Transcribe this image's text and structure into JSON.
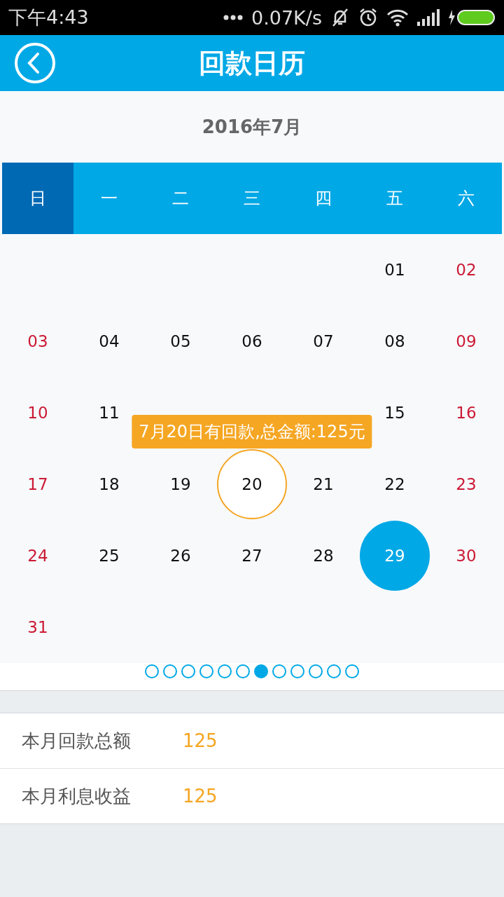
{
  "status_bar": {
    "time": "下午4:43",
    "speed": "0.07K/s"
  },
  "header": {
    "title": "回款日历"
  },
  "month": "2016年7月",
  "weekdays": [
    {
      "label": "日",
      "selected": true
    },
    {
      "label": "一",
      "selected": false
    },
    {
      "label": "二",
      "selected": false
    },
    {
      "label": "三",
      "selected": false
    },
    {
      "label": "四",
      "selected": false
    },
    {
      "label": "五",
      "selected": false
    },
    {
      "label": "六",
      "selected": false
    }
  ],
  "weeks": [
    [
      {
        "kind": "blank"
      },
      {
        "kind": "blank"
      },
      {
        "kind": "blank"
      },
      {
        "kind": "blank"
      },
      {
        "kind": "blank"
      },
      {
        "kind": "day",
        "day": "01",
        "marked": false,
        "selected": false
      },
      {
        "kind": "day",
        "day": "02",
        "marked": false,
        "selected": false
      }
    ],
    [
      {
        "kind": "day",
        "day": "03",
        "marked": false,
        "selected": false
      },
      {
        "kind": "day",
        "day": "04",
        "marked": false,
        "selected": false
      },
      {
        "kind": "day",
        "day": "05",
        "marked": false,
        "selected": false
      },
      {
        "kind": "day",
        "day": "06",
        "marked": false,
        "selected": false
      },
      {
        "kind": "day",
        "day": "07",
        "marked": false,
        "selected": false
      },
      {
        "kind": "day",
        "day": "08",
        "marked": false,
        "selected": false
      },
      {
        "kind": "day",
        "day": "09",
        "marked": false,
        "selected": false
      }
    ],
    [
      {
        "kind": "day",
        "day": "10",
        "marked": false,
        "selected": false
      },
      {
        "kind": "day",
        "day": "11",
        "marked": false,
        "selected": false
      },
      {
        "kind": "blank"
      },
      {
        "kind": "blank"
      },
      {
        "kind": "blank"
      },
      {
        "kind": "day",
        "day": "15",
        "marked": false,
        "selected": false
      },
      {
        "kind": "day",
        "day": "16",
        "marked": false,
        "selected": false
      }
    ],
    [
      {
        "kind": "day",
        "day": "17",
        "marked": false,
        "selected": false
      },
      {
        "kind": "day",
        "day": "18",
        "marked": false,
        "selected": false
      },
      {
        "kind": "day",
        "day": "19",
        "marked": false,
        "selected": false
      },
      {
        "kind": "day",
        "day": "20",
        "marked": true,
        "selected": false
      },
      {
        "kind": "day",
        "day": "21",
        "marked": false,
        "selected": false
      },
      {
        "kind": "day",
        "day": "22",
        "marked": false,
        "selected": false
      },
      {
        "kind": "day",
        "day": "23",
        "marked": false,
        "selected": false
      }
    ],
    [
      {
        "kind": "day",
        "day": "24",
        "marked": false,
        "selected": false
      },
      {
        "kind": "day",
        "day": "25",
        "marked": false,
        "selected": false
      },
      {
        "kind": "day",
        "day": "26",
        "marked": false,
        "selected": false
      },
      {
        "kind": "day",
        "day": "27",
        "marked": false,
        "selected": false
      },
      {
        "kind": "day",
        "day": "28",
        "marked": false,
        "selected": false
      },
      {
        "kind": "day",
        "day": "29",
        "marked": false,
        "selected": true
      },
      {
        "kind": "day",
        "day": "30",
        "marked": false,
        "selected": false
      }
    ],
    [
      {
        "kind": "day",
        "day": "31",
        "marked": false,
        "selected": false
      },
      {
        "kind": "blank"
      },
      {
        "kind": "blank"
      },
      {
        "kind": "blank"
      },
      {
        "kind": "blank"
      },
      {
        "kind": "blank"
      },
      {
        "kind": "blank"
      }
    ]
  ],
  "tooltip": "7月20日有回款,总金额:125元",
  "pages": [
    {
      "selected": false
    },
    {
      "selected": false
    },
    {
      "selected": false
    },
    {
      "selected": false
    },
    {
      "selected": false
    },
    {
      "selected": false
    },
    {
      "selected": true
    },
    {
      "selected": false
    },
    {
      "selected": false
    },
    {
      "selected": false
    },
    {
      "selected": false
    },
    {
      "selected": false
    }
  ],
  "summary": [
    {
      "label": "本月回款总额",
      "value": "125"
    },
    {
      "label": "本月利息收益",
      "value": "125"
    }
  ]
}
